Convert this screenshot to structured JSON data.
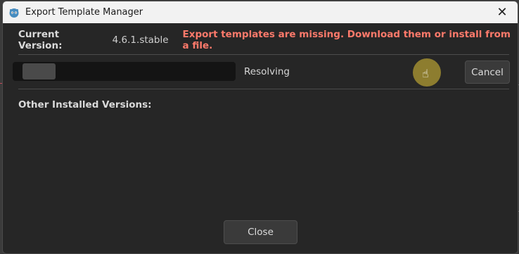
{
  "window": {
    "title": "Export Template Manager",
    "icon": "godot-icon",
    "close_icon": "close-icon"
  },
  "current": {
    "label": "Current Version:",
    "version": "4.6.1.stable",
    "warning": "Export templates are missing. Download them or install from a file."
  },
  "download": {
    "status": "Resolving",
    "cancel_label": "Cancel"
  },
  "other": {
    "label": "Other Installed Versions:"
  },
  "footer": {
    "close_label": "Close"
  },
  "colors": {
    "warning": "#ff7a6b",
    "window_bg": "#262626",
    "titlebar_bg": "#f2f2f2"
  }
}
